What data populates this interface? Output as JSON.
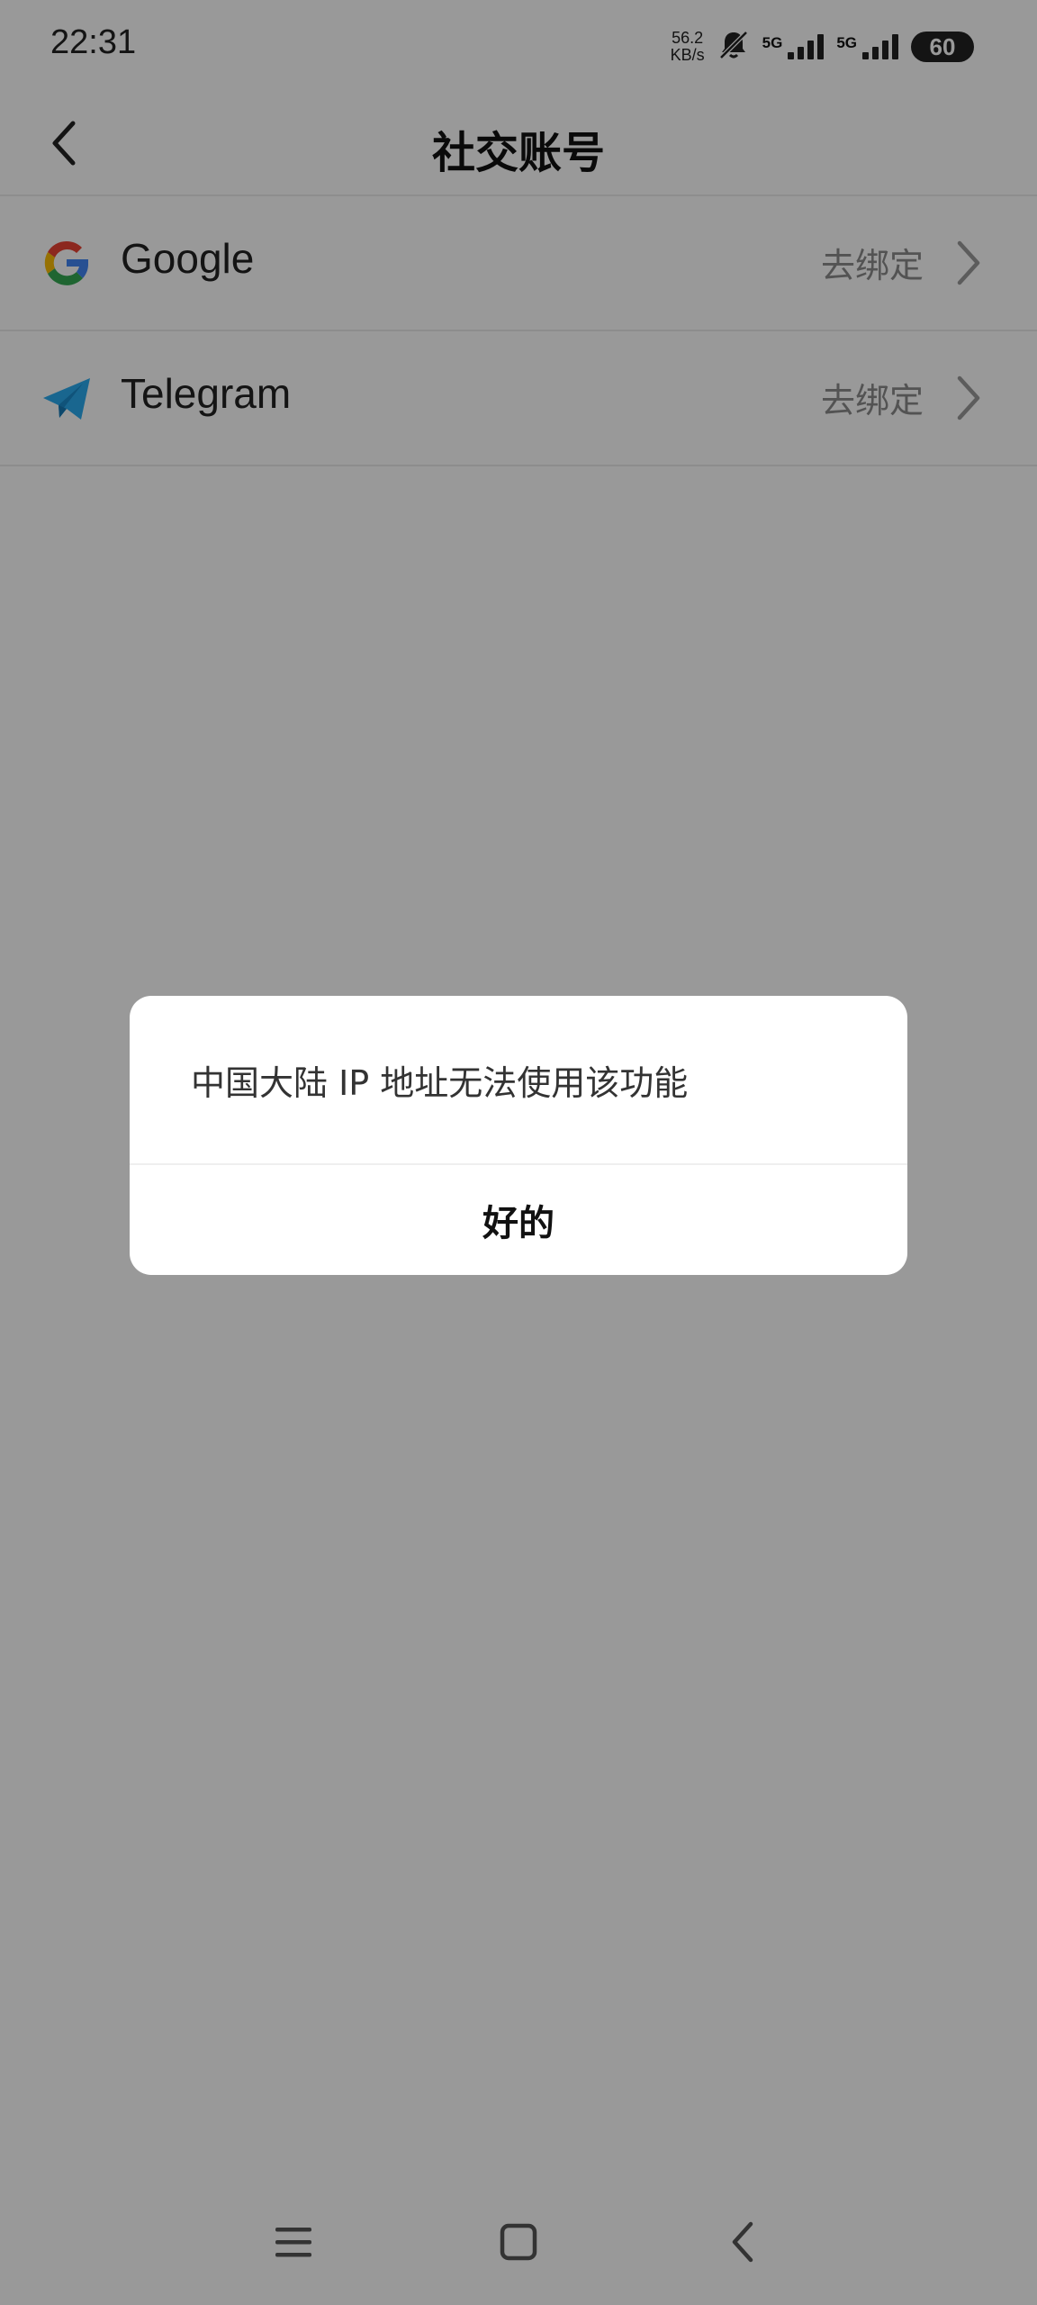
{
  "status": {
    "time": "22:31",
    "speed_value": "56.2",
    "speed_unit": "KB/s",
    "sim1_label": "5G",
    "sim2_label": "5G",
    "battery": "60"
  },
  "header": {
    "title": "社交账号"
  },
  "accounts": [
    {
      "name": "Google",
      "action": "去绑定",
      "icon": "google-icon"
    },
    {
      "name": "Telegram",
      "action": "去绑定",
      "icon": "telegram-icon"
    }
  ],
  "dialog": {
    "message": "中国大陆 IP 地址无法使用该功能",
    "ok_label": "好的"
  },
  "navbar": {
    "icons": [
      "menu-icon",
      "home-square-icon",
      "back-icon"
    ]
  }
}
